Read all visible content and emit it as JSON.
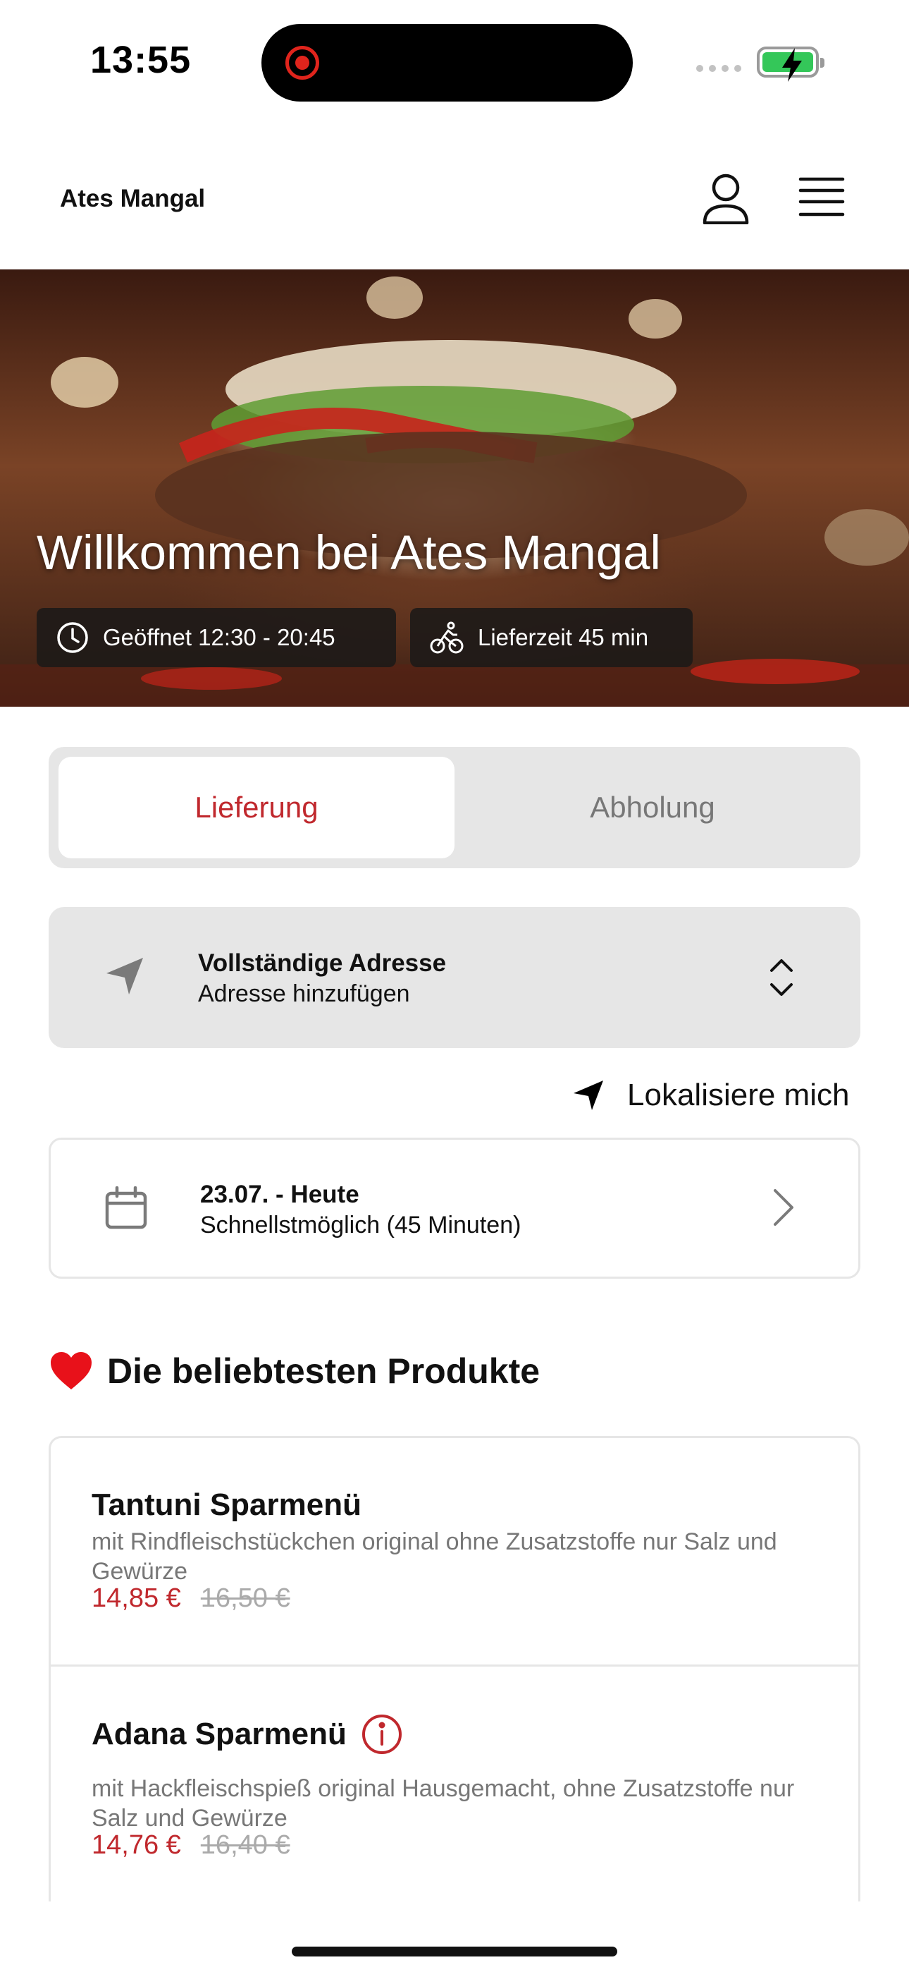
{
  "status_bar": {
    "time": "13:55"
  },
  "header": {
    "brand": "Ates Mangal"
  },
  "hero": {
    "title": "Willkommen bei Ates Mangal",
    "opening_hours": "Geöffnet 12:30 - 20:45",
    "delivery_time": "Lieferzeit 45 min"
  },
  "mode_toggle": {
    "delivery": "Lieferung",
    "pickup": "Abholung",
    "selected": "Lieferung"
  },
  "address": {
    "title": "Vollständige Adresse",
    "subtitle": "Adresse hinzufügen"
  },
  "locate": {
    "label": "Lokalisiere mich"
  },
  "schedule": {
    "title": "23.07. - Heute",
    "subtitle": "Schnellstmöglich (45 Minuten)"
  },
  "popular": {
    "title": "Die beliebtesten Produkte",
    "products": [
      {
        "name": "Tantuni Sparmenü",
        "description": "mit Rindfleischstückchen original ohne Zusatzstoffe nur Salz und Gewürze",
        "price": "14,85 €",
        "old_price": "16,50 €"
      },
      {
        "name": "Adana Sparmenü",
        "description": "mit Hackfleischspieß original Hausgemacht, ohne Zusatzstoffe nur Salz und Gewürze",
        "price": "14,76 €",
        "old_price": "16,40 €"
      }
    ]
  },
  "colors": {
    "accent": "#c0282d",
    "card_bg": "#e6e6e6",
    "muted_text": "#777777"
  }
}
